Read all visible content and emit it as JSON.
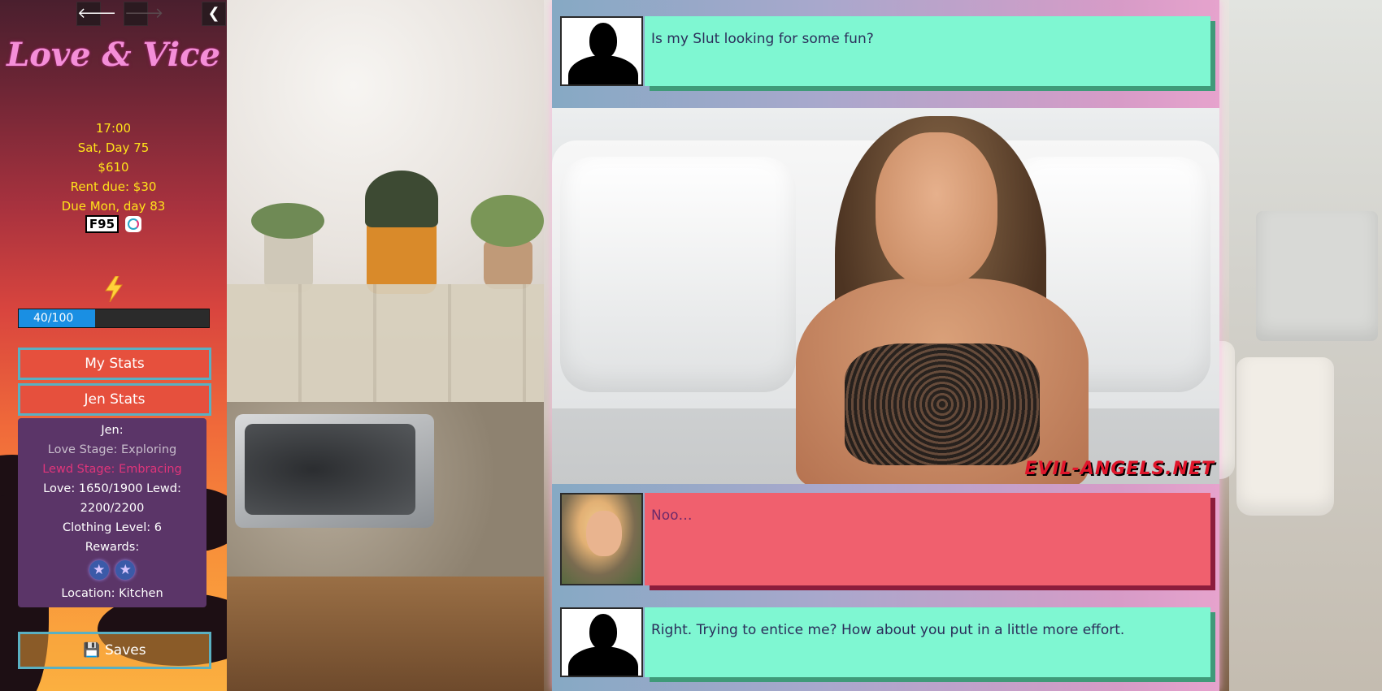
{
  "nav": {
    "back_icon": "arrow-left-icon",
    "forward_icon": "arrow-right-icon",
    "collapse_icon": "chevron-left-icon",
    "back_glyph": "🡐",
    "forward_glyph": "🡒",
    "collapse_glyph": "❮"
  },
  "game": {
    "title": "Love & Vice"
  },
  "status": {
    "time": "17:00",
    "date": "Sat, Day 75",
    "money": "$610",
    "rent": "Rent due: $30",
    "due": "Due Mon, day 83",
    "f95_badge": "F95"
  },
  "energy": {
    "icon": "lightning-icon",
    "label": "40/100",
    "value": 40,
    "max": 100,
    "fill_color": "#1a8fe3"
  },
  "buttons": {
    "my_stats": "My Stats",
    "jen_stats": "Jen Stats",
    "saves": "💾 Saves"
  },
  "jen_panel": {
    "name": "Jen:",
    "love_stage": "Love Stage: Exploring",
    "lewd_stage": "Lewd Stage: Embracing",
    "love_lewd_line1": "Love: 1650/1900 Lewd:",
    "love_lewd_line2": "2200/2200",
    "clothing": "Clothing Level: 6",
    "rewards": "Rewards:",
    "reward_stars": [
      "★",
      "★"
    ],
    "location": "Location: Kitchen"
  },
  "messages": [
    {
      "speaker": "silhouette",
      "text": "Is my Slut looking for some fun?",
      "style": "mint"
    },
    {
      "speaker": "jen",
      "text": "Noo…",
      "style": "red"
    },
    {
      "speaker": "silhouette",
      "text": "Right. Trying to entice me? How about you put in a little more effort.",
      "style": "mint"
    }
  ],
  "scene_image": {
    "watermark": "EVIL-ANGELS.NET"
  },
  "colors": {
    "mint_bubble": "#7ff7d2",
    "red_bubble": "#f0606e",
    "logo_pink": "#f48ed8",
    "info_yellow": "#ffe31a",
    "panel_purple": "#5b3568",
    "button_border": "#5ab0c2"
  }
}
